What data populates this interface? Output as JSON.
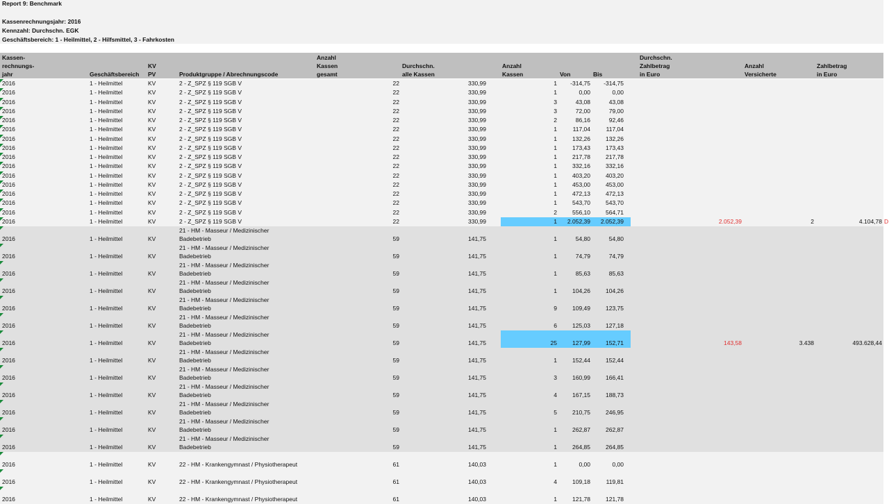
{
  "report": {
    "title": "Report 9: Benchmark",
    "year_line": "Kassenrechnungsjahr: 2016",
    "metric_line": "Kennzahl: Durchschn. EGK",
    "area_line": "Geschäftsbereich: 1 - Heilmittel, 2 - Hilfsmittel, 3 - Fahrkosten"
  },
  "columns": {
    "jahr": "Kassen-\nrechnungs-\njahr",
    "bereich": "Geschäftsbereich",
    "kvpv": "KV\nPV",
    "produkt": "Produktgruppe / Abrechnungscode",
    "anzahl_gesamt": "Anzahl\nKassen\ngesamt",
    "durchschn_alle": "Durchschn.\nalle Kassen",
    "anzahl_kassen": "Anzahl\nKassen",
    "von": "Von",
    "bis": "Bis",
    "zahlbetrag_avg": "Durchschn.\nZahlbetrag\nin Euro",
    "versicherte": "Anzahl\nVersicherte",
    "zahlbetrag": "Zahlbetrag\nin Euro"
  },
  "rows": [
    {
      "jahr": "2016",
      "bereich": "1 - Heilmittel",
      "kv": "KV",
      "p1": "2 - Z_SPZ § 119 SGB V",
      "p2": "",
      "gesamt": "22",
      "alle": "330,99",
      "kassen": "1",
      "von": "-314,75",
      "bis": "-314,75"
    },
    {
      "jahr": "2016",
      "bereich": "1 - Heilmittel",
      "kv": "KV",
      "p1": "2 - Z_SPZ § 119 SGB V",
      "p2": "",
      "gesamt": "22",
      "alle": "330,99",
      "kassen": "1",
      "von": "0,00",
      "bis": "0,00"
    },
    {
      "jahr": "2016",
      "bereich": "1 - Heilmittel",
      "kv": "KV",
      "p1": "2 - Z_SPZ § 119 SGB V",
      "p2": "",
      "gesamt": "22",
      "alle": "330,99",
      "kassen": "3",
      "von": "43,08",
      "bis": "43,08"
    },
    {
      "jahr": "2016",
      "bereich": "1 - Heilmittel",
      "kv": "KV",
      "p1": "2 - Z_SPZ § 119 SGB V",
      "p2": "",
      "gesamt": "22",
      "alle": "330,99",
      "kassen": "3",
      "von": "72,00",
      "bis": "79,00"
    },
    {
      "jahr": "2016",
      "bereich": "1 - Heilmittel",
      "kv": "KV",
      "p1": "2 - Z_SPZ § 119 SGB V",
      "p2": "",
      "gesamt": "22",
      "alle": "330,99",
      "kassen": "2",
      "von": "86,16",
      "bis": "92,46"
    },
    {
      "jahr": "2016",
      "bereich": "1 - Heilmittel",
      "kv": "KV",
      "p1": "2 - Z_SPZ § 119 SGB V",
      "p2": "",
      "gesamt": "22",
      "alle": "330,99",
      "kassen": "1",
      "von": "117,04",
      "bis": "117,04"
    },
    {
      "jahr": "2016",
      "bereich": "1 - Heilmittel",
      "kv": "KV",
      "p1": "2 - Z_SPZ § 119 SGB V",
      "p2": "",
      "gesamt": "22",
      "alle": "330,99",
      "kassen": "1",
      "von": "132,26",
      "bis": "132,26"
    },
    {
      "jahr": "2016",
      "bereich": "1 - Heilmittel",
      "kv": "KV",
      "p1": "2 - Z_SPZ § 119 SGB V",
      "p2": "",
      "gesamt": "22",
      "alle": "330,99",
      "kassen": "1",
      "von": "173,43",
      "bis": "173,43"
    },
    {
      "jahr": "2016",
      "bereich": "1 - Heilmittel",
      "kv": "KV",
      "p1": "2 - Z_SPZ § 119 SGB V",
      "p2": "",
      "gesamt": "22",
      "alle": "330,99",
      "kassen": "1",
      "von": "217,78",
      "bis": "217,78"
    },
    {
      "jahr": "2016",
      "bereich": "1 - Heilmittel",
      "kv": "KV",
      "p1": "2 - Z_SPZ § 119 SGB V",
      "p2": "",
      "gesamt": "22",
      "alle": "330,99",
      "kassen": "1",
      "von": "332,16",
      "bis": "332,16"
    },
    {
      "jahr": "2016",
      "bereich": "1 - Heilmittel",
      "kv": "KV",
      "p1": "2 - Z_SPZ § 119 SGB V",
      "p2": "",
      "gesamt": "22",
      "alle": "330,99",
      "kassen": "1",
      "von": "403,20",
      "bis": "403,20"
    },
    {
      "jahr": "2016",
      "bereich": "1 - Heilmittel",
      "kv": "KV",
      "p1": "2 - Z_SPZ § 119 SGB V",
      "p2": "",
      "gesamt": "22",
      "alle": "330,99",
      "kassen": "1",
      "von": "453,00",
      "bis": "453,00"
    },
    {
      "jahr": "2016",
      "bereich": "1 - Heilmittel",
      "kv": "KV",
      "p1": "2 - Z_SPZ § 119 SGB V",
      "p2": "",
      "gesamt": "22",
      "alle": "330,99",
      "kassen": "1",
      "von": "472,13",
      "bis": "472,13"
    },
    {
      "jahr": "2016",
      "bereich": "1 - Heilmittel",
      "kv": "KV",
      "p1": "2 - Z_SPZ § 119 SGB V",
      "p2": "",
      "gesamt": "22",
      "alle": "330,99",
      "kassen": "1",
      "von": "543,70",
      "bis": "543,70"
    },
    {
      "jahr": "2016",
      "bereich": "1 - Heilmittel",
      "kv": "KV",
      "p1": "2 - Z_SPZ § 119 SGB V",
      "p2": "",
      "gesamt": "22",
      "alle": "330,99",
      "kassen": "2",
      "von": "556,10",
      "bis": "564,71"
    },
    {
      "jahr": "2016",
      "bereich": "1 - Heilmittel",
      "kv": "KV",
      "p1": "2 - Z_SPZ § 119 SGB V",
      "p2": "",
      "gesamt": "22",
      "alle": "330,99",
      "kassen": "1",
      "von": "2.052,39",
      "bis": "2.052,39",
      "highlight": true,
      "zb_avg": "2.052,39",
      "vers": "2",
      "zb": "4.104,78",
      "overflow": "D"
    },
    {
      "jahr": "2016",
      "bereich": "1 - Heilmittel",
      "kv": "KV",
      "p1": "21 - HM - Masseur / Medizinischer",
      "p2": "Badebetrieb",
      "gesamt": "59",
      "alle": "141,75",
      "kassen": "1",
      "von": "54,80",
      "bis": "54,80"
    },
    {
      "jahr": "2016",
      "bereich": "1 - Heilmittel",
      "kv": "KV",
      "p1": "21 - HM - Masseur / Medizinischer",
      "p2": "Badebetrieb",
      "gesamt": "59",
      "alle": "141,75",
      "kassen": "1",
      "von": "74,79",
      "bis": "74,79"
    },
    {
      "jahr": "2016",
      "bereich": "1 - Heilmittel",
      "kv": "KV",
      "p1": "21 - HM - Masseur / Medizinischer",
      "p2": "Badebetrieb",
      "gesamt": "59",
      "alle": "141,75",
      "kassen": "1",
      "von": "85,63",
      "bis": "85,63"
    },
    {
      "jahr": "2016",
      "bereich": "1 - Heilmittel",
      "kv": "KV",
      "p1": "21 - HM - Masseur / Medizinischer",
      "p2": "Badebetrieb",
      "gesamt": "59",
      "alle": "141,75",
      "kassen": "1",
      "von": "104,26",
      "bis": "104,26"
    },
    {
      "jahr": "2016",
      "bereich": "1 - Heilmittel",
      "kv": "KV",
      "p1": "21 - HM - Masseur / Medizinischer",
      "p2": "Badebetrieb",
      "gesamt": "59",
      "alle": "141,75",
      "kassen": "9",
      "von": "109,49",
      "bis": "123,75"
    },
    {
      "jahr": "2016",
      "bereich": "1 - Heilmittel",
      "kv": "KV",
      "p1": "21 - HM - Masseur / Medizinischer",
      "p2": "Badebetrieb",
      "gesamt": "59",
      "alle": "141,75",
      "kassen": "6",
      "von": "125,03",
      "bis": "127,18"
    },
    {
      "jahr": "2016",
      "bereich": "1 - Heilmittel",
      "kv": "KV",
      "p1": "21 - HM - Masseur / Medizinischer",
      "p2": "Badebetrieb",
      "gesamt": "59",
      "alle": "141,75",
      "kassen": "25",
      "von": "127,99",
      "bis": "152,71",
      "highlight": true,
      "zb_avg": "143,58",
      "vers": "3.438",
      "zb": "493.628,44"
    },
    {
      "jahr": "2016",
      "bereich": "1 - Heilmittel",
      "kv": "KV",
      "p1": "21 - HM - Masseur / Medizinischer",
      "p2": "Badebetrieb",
      "gesamt": "59",
      "alle": "141,75",
      "kassen": "1",
      "von": "152,44",
      "bis": "152,44"
    },
    {
      "jahr": "2016",
      "bereich": "1 - Heilmittel",
      "kv": "KV",
      "p1": "21 - HM - Masseur / Medizinischer",
      "p2": "Badebetrieb",
      "gesamt": "59",
      "alle": "141,75",
      "kassen": "3",
      "von": "160,99",
      "bis": "166,41"
    },
    {
      "jahr": "2016",
      "bereich": "1 - Heilmittel",
      "kv": "KV",
      "p1": "21 - HM - Masseur / Medizinischer",
      "p2": "Badebetrieb",
      "gesamt": "59",
      "alle": "141,75",
      "kassen": "4",
      "von": "167,15",
      "bis": "188,73"
    },
    {
      "jahr": "2016",
      "bereich": "1 - Heilmittel",
      "kv": "KV",
      "p1": "21 - HM - Masseur / Medizinischer",
      "p2": "Badebetrieb",
      "gesamt": "59",
      "alle": "141,75",
      "kassen": "5",
      "von": "210,75",
      "bis": "246,95"
    },
    {
      "jahr": "2016",
      "bereich": "1 - Heilmittel",
      "kv": "KV",
      "p1": "21 - HM - Masseur / Medizinischer",
      "p2": "Badebetrieb",
      "gesamt": "59",
      "alle": "141,75",
      "kassen": "1",
      "von": "262,87",
      "bis": "262,87"
    },
    {
      "jahr": "2016",
      "bereich": "1 - Heilmittel",
      "kv": "KV",
      "p1": "21 - HM - Masseur / Medizinischer",
      "p2": "Badebetrieb",
      "gesamt": "59",
      "alle": "141,75",
      "kassen": "1",
      "von": "264,85",
      "bis": "264,85"
    },
    {
      "jahr": "2016",
      "bereich": "1 - Heilmittel",
      "kv": "KV",
      "p1": "22 - HM - Krankengymnast / Physiotherapeut",
      "p2": "",
      "gesamt": "61",
      "alle": "140,03",
      "kassen": "1",
      "von": "0,00",
      "bis": "0,00"
    },
    {
      "jahr": "2016",
      "bereich": "1 - Heilmittel",
      "kv": "KV",
      "p1": "22 - HM - Krankengymnast / Physiotherapeut",
      "p2": "",
      "gesamt": "61",
      "alle": "140,03",
      "kassen": "4",
      "von": "109,18",
      "bis": "119,81"
    },
    {
      "jahr": "2016",
      "bereich": "1 - Heilmittel",
      "kv": "KV",
      "p1": "22 - HM - Krankengymnast / Physiotherapeut",
      "p2": "",
      "gesamt": "61",
      "alle": "140,03",
      "kassen": "1",
      "von": "121,78",
      "bis": "121,78"
    }
  ],
  "colors": {
    "group_a_bg": "#f2f2f2",
    "group_b_bg": "#e0e0e0",
    "header_bg": "#bfbfbf",
    "highlight": "#66ccff",
    "red_text": "#e03030",
    "marker": "#1a8a3a"
  }
}
